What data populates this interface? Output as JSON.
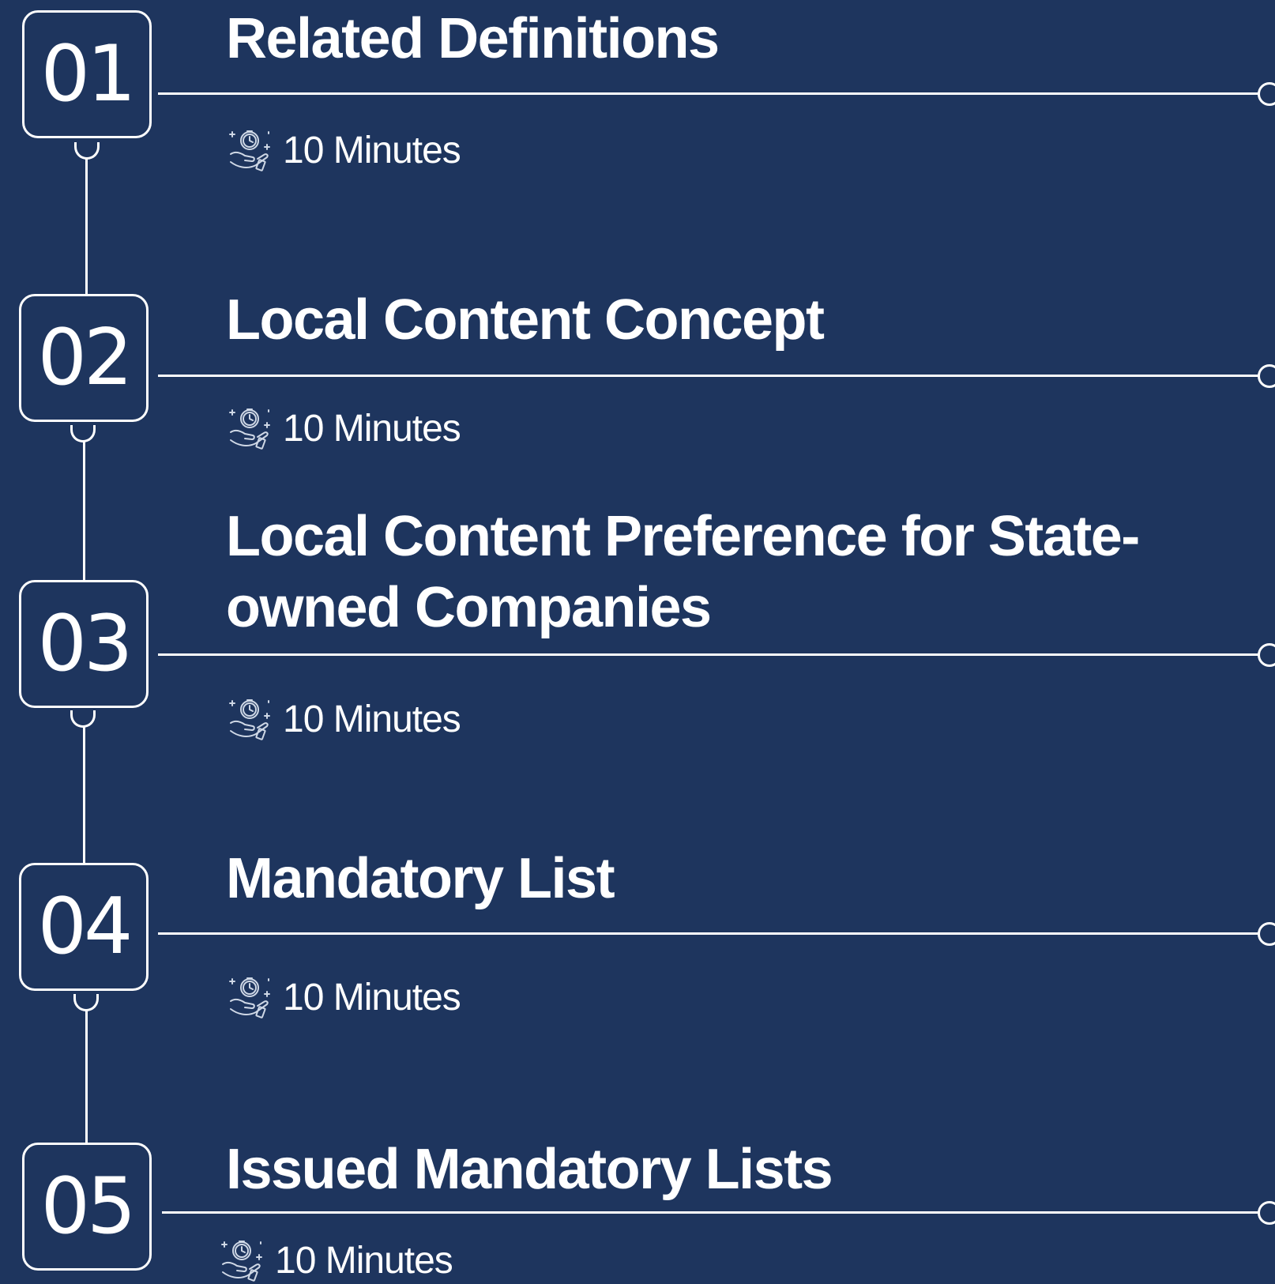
{
  "colors": {
    "background": "#1e355e",
    "foreground": "#ffffff"
  },
  "steps": [
    {
      "number": "01",
      "title": "Related Definitions",
      "duration": "10 Minutes",
      "icon": "clock-hand-icon"
    },
    {
      "number": "02",
      "title": "Local Content Concept",
      "duration": "10 Minutes",
      "icon": "clock-hand-icon"
    },
    {
      "number": "03",
      "title": "Local Content Preference for State-owned Companies",
      "duration": "10 Minutes",
      "icon": "clock-hand-icon"
    },
    {
      "number": "04",
      "title": "Mandatory List",
      "duration": "10 Minutes",
      "icon": "clock-hand-icon"
    },
    {
      "number": "05",
      "title": "Issued Mandatory Lists",
      "duration": "10 Minutes",
      "icon": "clock-hand-icon"
    }
  ]
}
